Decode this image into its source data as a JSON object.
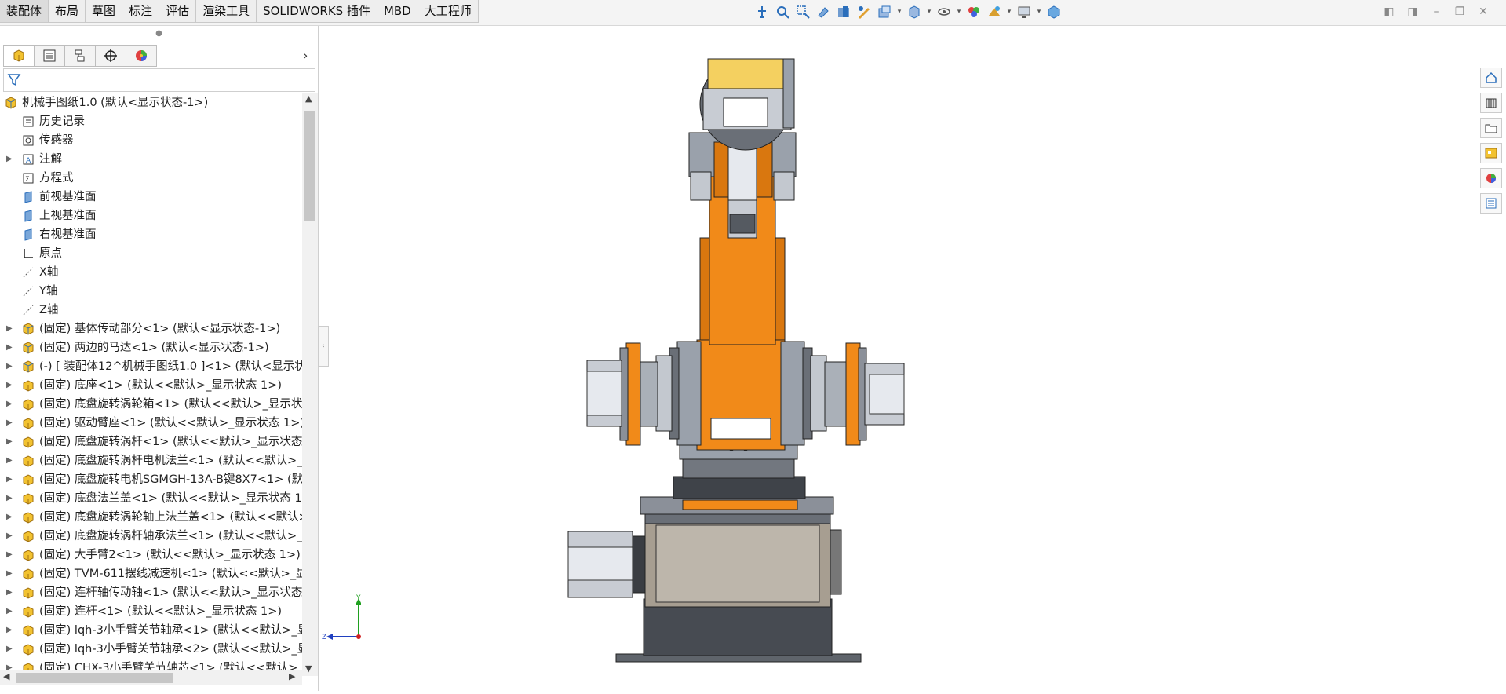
{
  "menu_tabs": [
    "装配体",
    "布局",
    "草图",
    "标注",
    "评估",
    "渲染工具",
    "SOLIDWORKS 插件",
    "MBD",
    "大工程师"
  ],
  "active_tab": "装配体",
  "toolbar_icons": [
    "view-orientation-icon",
    "zoom-fit-icon",
    "zoom-area-icon",
    "previous-view-icon",
    "section-view-icon",
    "dynamic-annotation-icon",
    "view-orientation-dropdown-icon",
    "display-style-icon",
    "hide-show-items-icon",
    "edit-appearance-icon",
    "apply-scene-icon",
    "view-settings-icon",
    "3d-view-icon"
  ],
  "window_controls": [
    "restore-pane-icon",
    "maximize-pane-icon",
    "minimize-icon",
    "restore-icon",
    "close-icon"
  ],
  "manager_tabs": [
    "feature-manager-icon",
    "property-manager-icon",
    "configuration-manager-icon",
    "dimxpert-manager-icon",
    "display-manager-icon"
  ],
  "tree": {
    "root": "机械手图纸1.0  (默认<显示状态-1>)",
    "items": [
      {
        "label": "历史记录",
        "icon": "history-icon",
        "expandable": false
      },
      {
        "label": "传感器",
        "icon": "sensor-icon",
        "expandable": false
      },
      {
        "label": "注解",
        "icon": "annotation-icon",
        "expandable": true
      },
      {
        "label": "方程式",
        "icon": "equation-icon",
        "expandable": false
      },
      {
        "label": "前视基准面",
        "icon": "plane-icon",
        "expandable": false
      },
      {
        "label": "上视基准面",
        "icon": "plane-icon",
        "expandable": false
      },
      {
        "label": "右视基准面",
        "icon": "plane-icon",
        "expandable": false
      },
      {
        "label": "原点",
        "icon": "origin-icon",
        "expandable": false
      },
      {
        "label": "X轴",
        "icon": "axis-icon",
        "expandable": false
      },
      {
        "label": "Y轴",
        "icon": "axis-icon",
        "expandable": false
      },
      {
        "label": "Z轴",
        "icon": "axis-icon",
        "expandable": false
      },
      {
        "label": "(固定) 基体传动部分<1> (默认<显示状态-1>)",
        "icon": "subassembly-icon",
        "expandable": true
      },
      {
        "label": "(固定) 两边的马达<1> (默认<显示状态-1>)",
        "icon": "subassembly-icon",
        "expandable": true
      },
      {
        "label": "(-) [ 装配体12^机械手图纸1.0 ]<1> (默认<显示状",
        "icon": "subassembly-icon",
        "expandable": true
      },
      {
        "label": "(固定) 底座<1> (默认<<默认>_显示状态 1>)",
        "icon": "part-icon",
        "expandable": true
      },
      {
        "label": "(固定) 底盘旋转涡轮箱<1> (默认<<默认>_显示状",
        "icon": "part-icon",
        "expandable": true
      },
      {
        "label": "(固定) 驱动臂座<1> (默认<<默认>_显示状态 1>)",
        "icon": "part-icon",
        "expandable": true
      },
      {
        "label": "(固定) 底盘旋转涡杆<1> (默认<<默认>_显示状态",
        "icon": "part-icon",
        "expandable": true
      },
      {
        "label": "(固定) 底盘旋转涡杆电机法兰<1> (默认<<默认>_",
        "icon": "part-icon",
        "expandable": true
      },
      {
        "label": "(固定) 底盘旋转电机SGMGH-13A-B键8X7<1> (默",
        "icon": "part-icon",
        "expandable": true
      },
      {
        "label": "(固定) 底盘法兰盖<1> (默认<<默认>_显示状态 1",
        "icon": "part-icon",
        "expandable": true
      },
      {
        "label": "(固定) 底盘旋转涡轮轴上法兰盖<1> (默认<<默认>",
        "icon": "part-icon",
        "expandable": true
      },
      {
        "label": "(固定) 底盘旋转涡杆轴承法兰<1> (默认<<默认>_",
        "icon": "part-icon",
        "expandable": true
      },
      {
        "label": "(固定) 大手臂2<1> (默认<<默认>_显示状态 1>)",
        "icon": "part-icon",
        "expandable": true
      },
      {
        "label": "(固定) TVM-611摆线减速机<1> (默认<<默认>_显",
        "icon": "part-icon",
        "expandable": true
      },
      {
        "label": "(固定) 连杆轴传动轴<1> (默认<<默认>_显示状态",
        "icon": "part-icon",
        "expandable": true
      },
      {
        "label": "(固定) 连杆<1> (默认<<默认>_显示状态 1>)",
        "icon": "part-icon",
        "expandable": true
      },
      {
        "label": "(固定) lqh-3小手臂关节轴承<1> (默认<<默认>_显",
        "icon": "part-icon",
        "expandable": true
      },
      {
        "label": "(固定) lqh-3小手臂关节轴承<2> (默认<<默认>_显",
        "icon": "part-icon",
        "expandable": true
      },
      {
        "label": "(固定) CHX-3小手臂关节轴芯<1> (默认<<默认>_",
        "icon": "part-icon",
        "expandable": true
      }
    ]
  },
  "right_tools": [
    "home-icon",
    "parts-library-icon",
    "open-folder-icon",
    "view-palette-icon",
    "appearances-icon",
    "custom-properties-icon"
  ],
  "triad": {
    "x_label": "Z",
    "y_label": "Y"
  },
  "colors": {
    "orange": "#f18a19",
    "steel": "#9aa1ab",
    "dark": "#3b3f45"
  }
}
